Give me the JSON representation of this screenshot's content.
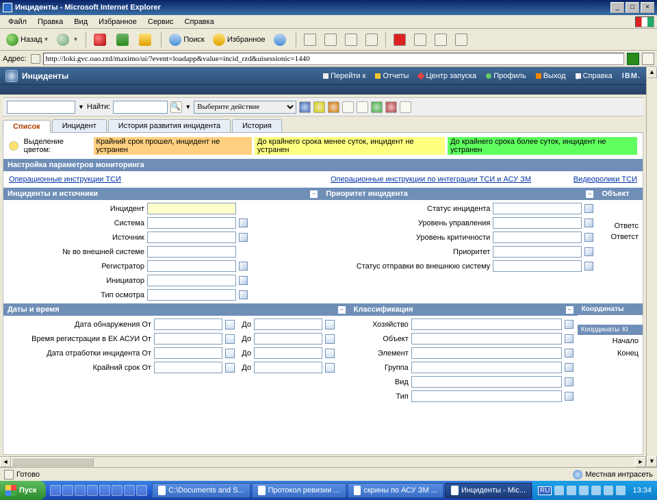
{
  "window": {
    "title": "Инциденты - Microsoft Internet Explorer"
  },
  "ie_menu": [
    "Файл",
    "Правка",
    "Вид",
    "Избранное",
    "Сервис",
    "Справка"
  ],
  "ie_toolbar": {
    "back": "Назад",
    "search": "Поиск",
    "favorites": "Избранное"
  },
  "address": {
    "label": "Адрес:",
    "url": "http://loki.gvc.oao.rzd/maximo/ui/?event=loadapp&value=incid_rzd&uisessionic=1440"
  },
  "mx": {
    "app_title": "Инциденты",
    "links": {
      "goto": "Перейти к",
      "reports": "Отчеты",
      "startcenter": "Центр запуска",
      "profile": "Профиль",
      "signout": "Выход",
      "help": "Справка"
    },
    "logo": "IBM."
  },
  "mx_toolbar": {
    "find_label": "Найти:",
    "action_placeholder": "Выберите действие"
  },
  "tabs": [
    "Список",
    "Инцидент",
    "История развития инцидента",
    "История"
  ],
  "legend": {
    "prefix": "Выделение цветом:",
    "l1": "Крайний срок прошел, инцидент не устранен",
    "l2": "До крайнего срока менее суток, инцидент не устранен",
    "l3": "До крайнего срока более суток, инцидент не устранен"
  },
  "section_params": "Настройка параметров мониторинга",
  "links_row": {
    "a": "Операционные инструкции ТСИ",
    "b": "Операционные инструкции по интеграции ТСИ и АСУ ЗМ",
    "c": "Видеоролики ТСИ"
  },
  "headers": {
    "sources": "Инциденты и источники",
    "priority": "Приоритет инцидента",
    "object": "Объект",
    "dates": "Даты и время",
    "class": "Классификация",
    "coords": "Координаты",
    "coords_sub1": "Координаты",
    "coords_sub2": "КІ"
  },
  "fields_left": {
    "incident": "Инцидент",
    "system": "Система",
    "source": "Источник",
    "extnum": "№ во внешней системе",
    "registrar": "Регистратор",
    "initiator": "Инициатор",
    "insptype": "Тип осмотра"
  },
  "fields_right": {
    "status": "Статус инцидента",
    "mgmt_level": "Уровень управления",
    "criticality": "Уровень критичности",
    "priority": "Приоритет",
    "send_status": "Статус отправки во внешнюю систему"
  },
  "object_col": {
    "r1": "Ответс",
    "r2": "Ответст"
  },
  "dates": {
    "detect": "Дата обнаружения От",
    "reg": "Время регистрации в ЕК АСУИ От",
    "proc": "Дата отработки инцидента От",
    "deadline": "Крайний срок От",
    "to": "До"
  },
  "class_fields": {
    "economy": "Хозяйство",
    "object": "Объект",
    "element": "Элемент",
    "group": "Группа",
    "kind": "Вид",
    "type": "Тип"
  },
  "coords": {
    "start": "Начало",
    "end": "Конец"
  },
  "status_bar": {
    "ready": "Готово",
    "zone": "Местная интрасеть"
  },
  "taskbar": {
    "start": "Пуск",
    "buttons": [
      "C:\\Documents and S...",
      "Протокол ревизии ...",
      "скрины по АСУ ЗМ ...",
      "Инциденты - Mic..."
    ],
    "lang": "RU",
    "clock": "13:34"
  }
}
